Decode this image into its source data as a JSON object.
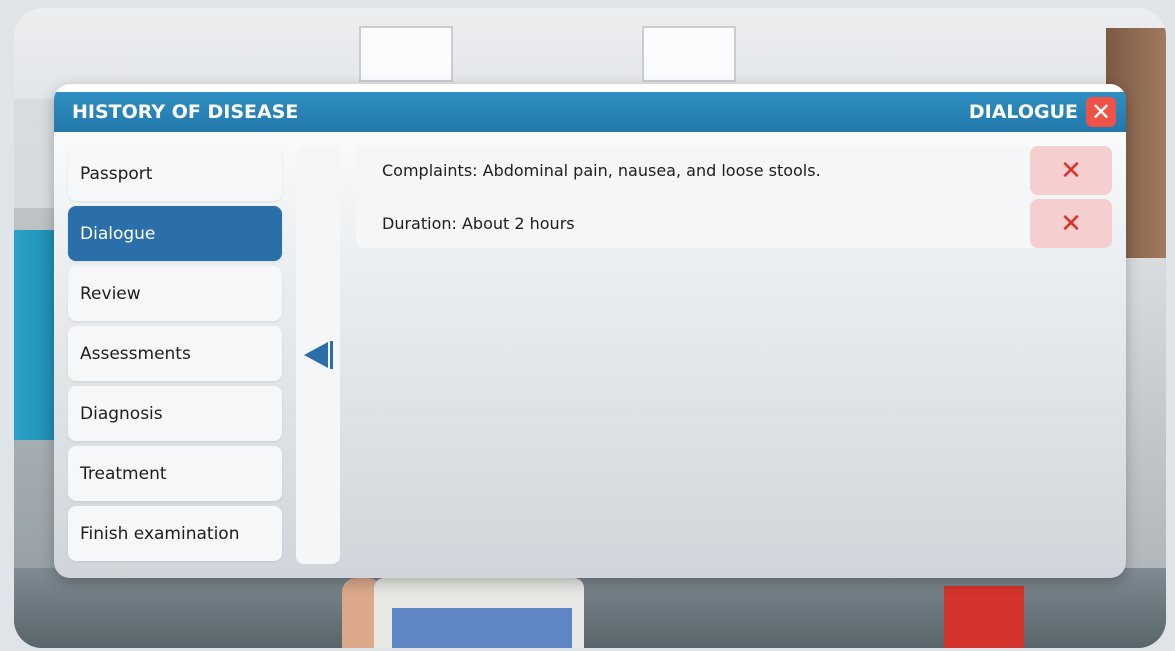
{
  "header": {
    "title": "HISTORY OF DISEASE",
    "section": "DIALOGUE",
    "close_icon": "close-icon"
  },
  "sidebar": {
    "items": [
      {
        "label": "Passport",
        "active": false
      },
      {
        "label": "Dialogue",
        "active": true
      },
      {
        "label": "Review",
        "active": false
      },
      {
        "label": "Assessments",
        "active": false
      },
      {
        "label": "Diagnosis",
        "active": false
      },
      {
        "label": "Treatment",
        "active": false
      },
      {
        "label": "Finish examination",
        "active": false
      }
    ]
  },
  "collapse": {
    "icon": "collapse-left-arrow-icon"
  },
  "records": [
    {
      "text": "Complaints: Abdominal pain, nausea, and loose stools.",
      "delete_icon": "delete-icon"
    },
    {
      "text": "Duration: About 2 hours",
      "delete_icon": "delete-icon"
    }
  ],
  "colors": {
    "header": "#2278ab",
    "active_item": "#2a6faa",
    "close": "#ef5348",
    "delete_bg": "#f5cfcf",
    "delete_x": "#d8332a"
  }
}
